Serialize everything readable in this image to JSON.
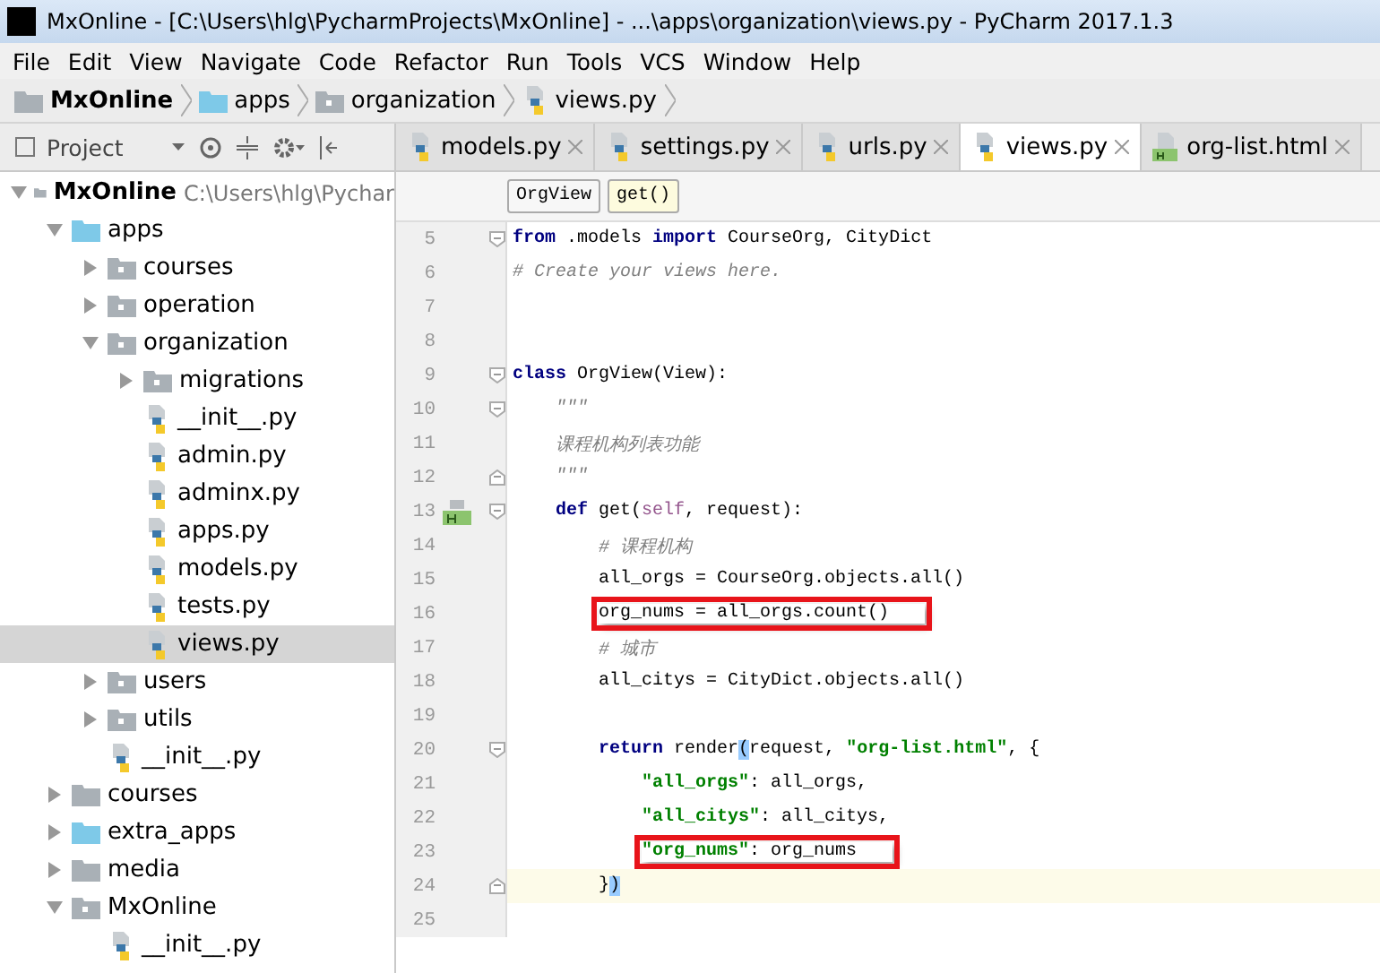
{
  "window": {
    "title": "MxOnline - [C:\\Users\\hlg\\PycharmProjects\\MxOnline] - ...\\apps\\organization\\views.py - PyCharm 2017.1.3"
  },
  "menu": [
    "File",
    "Edit",
    "View",
    "Navigate",
    "Code",
    "Refactor",
    "Run",
    "Tools",
    "VCS",
    "Window",
    "Help"
  ],
  "breadcrumb": [
    {
      "label": "MxOnline",
      "kind": "root"
    },
    {
      "label": "apps",
      "kind": "source-folder"
    },
    {
      "label": "organization",
      "kind": "package"
    },
    {
      "label": "views.py",
      "kind": "python-file"
    }
  ],
  "project_panel": {
    "title": "Project"
  },
  "tabs": [
    {
      "label": "models.py",
      "kind": "python-file",
      "selected": false
    },
    {
      "label": "settings.py",
      "kind": "python-file",
      "selected": false
    },
    {
      "label": "urls.py",
      "kind": "python-file",
      "selected": false
    },
    {
      "label": "views.py",
      "kind": "python-file",
      "selected": true
    },
    {
      "label": "org-list.html",
      "kind": "html-file",
      "selected": false
    }
  ],
  "tree": [
    {
      "label": "MxOnline",
      "path": "C:\\Users\\hlg\\Pychar",
      "kind": "folder",
      "expanded": true,
      "selected": false,
      "children": [
        {
          "label": "apps",
          "kind": "source-folder",
          "expanded": true,
          "selected": false,
          "children": [
            {
              "label": "courses",
              "kind": "package",
              "expanded": false,
              "selected": false
            },
            {
              "label": "operation",
              "kind": "package",
              "expanded": false,
              "selected": false
            },
            {
              "label": "organization",
              "kind": "package",
              "expanded": true,
              "selected": false,
              "children": [
                {
                  "label": "migrations",
                  "kind": "package",
                  "expanded": false,
                  "selected": false
                },
                {
                  "label": "__init__.py",
                  "kind": "python-file",
                  "selected": false
                },
                {
                  "label": "admin.py",
                  "kind": "python-file",
                  "selected": false
                },
                {
                  "label": "adminx.py",
                  "kind": "python-file",
                  "selected": false
                },
                {
                  "label": "apps.py",
                  "kind": "python-file",
                  "selected": false
                },
                {
                  "label": "models.py",
                  "kind": "python-file",
                  "selected": false
                },
                {
                  "label": "tests.py",
                  "kind": "python-file",
                  "selected": false
                },
                {
                  "label": "views.py",
                  "kind": "python-file",
                  "selected": true
                }
              ]
            },
            {
              "label": "users",
              "kind": "package",
              "expanded": false,
              "selected": false
            },
            {
              "label": "utils",
              "kind": "package",
              "expanded": false,
              "selected": false
            },
            {
              "label": "__init__.py",
              "kind": "python-file",
              "selected": false
            }
          ]
        },
        {
          "label": "courses",
          "kind": "folder",
          "expanded": false,
          "selected": false
        },
        {
          "label": "extra_apps",
          "kind": "source-folder",
          "expanded": false,
          "selected": false
        },
        {
          "label": "media",
          "kind": "folder",
          "expanded": false,
          "selected": false
        },
        {
          "label": "MxOnline",
          "kind": "package",
          "expanded": true,
          "selected": false,
          "children": [
            {
              "label": "__init__.py",
              "kind": "python-file",
              "selected": false
            }
          ]
        }
      ]
    }
  ],
  "editor_breadcrumb": [
    {
      "label": "OrgView",
      "selected": false
    },
    {
      "label": "get()",
      "selected": true
    }
  ],
  "code": [
    {
      "number": "5",
      "fold_start": true,
      "tokens": [
        {
          "kind": "keyword",
          "text": "from"
        },
        {
          "kind": "plain",
          "text": " .models "
        },
        {
          "kind": "keyword",
          "text": "import"
        },
        {
          "kind": "plain",
          "text": " CourseOrg, CityDict"
        }
      ]
    },
    {
      "number": "6",
      "tokens": [
        {
          "kind": "comment",
          "text": "# Create your views here."
        }
      ]
    },
    {
      "number": "7"
    },
    {
      "number": "8"
    },
    {
      "number": "9",
      "fold_start": true,
      "tokens": [
        {
          "kind": "keyword",
          "text": "class"
        },
        {
          "kind": "plain",
          "text": " OrgView(View):"
        }
      ]
    },
    {
      "number": "10",
      "fold_start": true,
      "tokens": [
        {
          "kind": "docstring",
          "text": "    \"\"\""
        }
      ]
    },
    {
      "number": "11",
      "tokens": [
        {
          "kind": "docstring",
          "text": "    课程机构列表功能"
        }
      ]
    },
    {
      "number": "12",
      "fold_end": true,
      "tokens": [
        {
          "kind": "docstring",
          "text": "    \"\"\""
        }
      ]
    },
    {
      "number": "13",
      "fold_start": true,
      "marker": true,
      "tokens": [
        {
          "kind": "keyword",
          "text": "    def"
        },
        {
          "kind": "plain",
          "text": " get("
        },
        {
          "kind": "self",
          "text": "self"
        },
        {
          "kind": "plain",
          "text": ", request):"
        }
      ]
    },
    {
      "number": "14",
      "tokens": [
        {
          "kind": "comment",
          "text": "        # 课程机构"
        }
      ]
    },
    {
      "number": "15",
      "tokens": [
        {
          "kind": "plain",
          "text": "        all_orgs = CourseOrg.objects.all()"
        }
      ]
    },
    {
      "number": "16",
      "boxed": true,
      "tokens": [
        {
          "kind": "plain",
          "text": "        org_nums = all_orgs.count()"
        }
      ]
    },
    {
      "number": "17",
      "tokens": [
        {
          "kind": "comment",
          "text": "        # 城市"
        }
      ]
    },
    {
      "number": "18",
      "tokens": [
        {
          "kind": "plain",
          "text": "        all_citys = CityDict.objects.all()"
        }
      ]
    },
    {
      "number": "19"
    },
    {
      "number": "20",
      "fold_start": true,
      "tokens": [
        {
          "kind": "keyword",
          "text": "        return"
        },
        {
          "kind": "plain",
          "text": " render"
        },
        {
          "kind": "brace",
          "text": "("
        },
        {
          "kind": "plain",
          "text": "request, "
        },
        {
          "kind": "string",
          "text": "\"org-list.html\""
        },
        {
          "kind": "plain",
          "text": ", {"
        }
      ]
    },
    {
      "number": "21",
      "tokens": [
        {
          "kind": "string",
          "text": "            \"all_orgs\""
        },
        {
          "kind": "plain",
          "text": ": all_orgs,"
        }
      ]
    },
    {
      "number": "22",
      "tokens": [
        {
          "kind": "string",
          "text": "            \"all_citys\""
        },
        {
          "kind": "plain",
          "text": ": all_citys,"
        }
      ]
    },
    {
      "number": "23",
      "boxed": true,
      "tokens": [
        {
          "kind": "string",
          "text": "            \"org_nums\""
        },
        {
          "kind": "plain",
          "text": ": org_nums"
        }
      ]
    },
    {
      "number": "24",
      "fold_end": true,
      "current": true,
      "tokens": [
        {
          "kind": "plain",
          "text": "        }"
        },
        {
          "kind": "brace",
          "text": ")"
        }
      ]
    },
    {
      "number": "25"
    }
  ]
}
